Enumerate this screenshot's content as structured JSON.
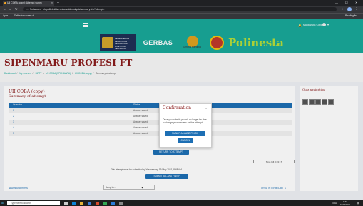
{
  "browser": {
    "tab_title": "UII COBA (copy): Attempt summ",
    "tab_close": "×",
    "new_tab": "+",
    "url": "elo.politeknikbm.unila.ac.id/mod/quiz/summary.php?attempt=",
    "security_label": "Not secure",
    "bookmarks": [
      "Apps",
      "Daftar kabupaten d..."
    ],
    "reading_list": "Reading list"
  },
  "site_header": {
    "user_name": "Mahasiswa Coba",
    "logos": {
      "kemdikbud": [
        "KEMENTERIAN",
        "PENDIDIKAN",
        "KEBUDAYAAN",
        "RISET, DAN",
        "TEKNOLOGI"
      ],
      "gerbang": "GERBAS",
      "kampus": "Kampus Merdeka",
      "polinela": "Polinesta"
    }
  },
  "page": {
    "title": "SIPENMARU PROFESI FT",
    "breadcrumbs": [
      "Dashboard",
      "My courses",
      "SIPTT",
      "UII COBA (SPENMARU)",
      "UII COBA (copy)",
      "Summary of attempt"
    ]
  },
  "quiz": {
    "title": "UII COBA (copy)",
    "subtitle": "Summary of attempt",
    "columns": [
      "Question",
      "Status"
    ],
    "rows": [
      {
        "num": "1",
        "status": "Answer saved"
      },
      {
        "num": "2",
        "status": "Answer saved"
      },
      {
        "num": "3",
        "status": "Answer saved"
      },
      {
        "num": "4",
        "status": "Answer saved"
      },
      {
        "num": "5",
        "status": "Answer saved"
      }
    ],
    "return_button": "RETURN TO ATTEMPT",
    "time_left": "Time left 0:23:17",
    "submission_note": "This attempt must be submitted by Wednesday, 19 May 2021, 8:48 AM.",
    "submit_button": "SUBMIT ALL AND FINISH",
    "prev_link": "◄ Announcements",
    "jump_select": "Jump to...",
    "next_link": "CRUD INTERMEDIET ►"
  },
  "quiz_nav": {
    "title": "Quiz navigation",
    "items": [
      "1",
      "2",
      "3",
      "4",
      "5"
    ]
  },
  "modal": {
    "title": "Confirmation",
    "close": "×",
    "body": "Once you submit, you will no longer be able to change your answers for this attempt.",
    "submit_button": "SUBMIT ALL AND FINISH",
    "cancel_button": "CANCEL"
  },
  "taskbar": {
    "search_placeholder": "Type here to search",
    "time": "8:47",
    "date": "19/05/2021",
    "lang": "ENG"
  },
  "colors": {
    "header_teal": "#19a89a",
    "title_red": "#8b1c1c",
    "primary_blue": "#1d6fb4"
  }
}
